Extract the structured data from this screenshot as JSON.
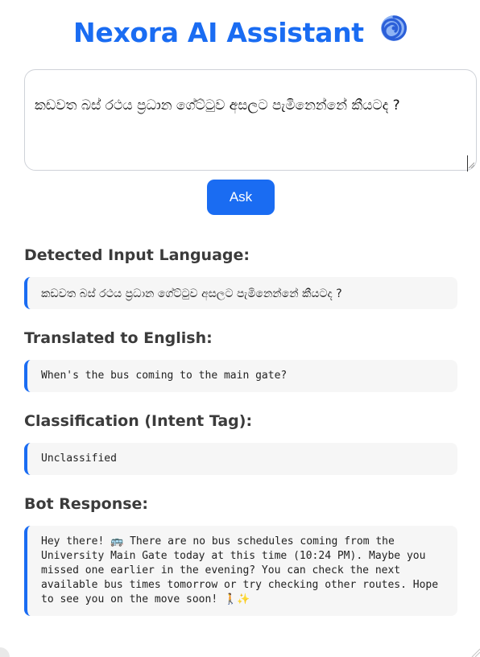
{
  "header": {
    "title": "Nexora AI Assistant",
    "icon": "cyclone-icon",
    "accent_color": "#1a6cf2"
  },
  "input": {
    "value": "කඩවත බස් රථය ප්‍රධාන ගේට්ටුව අසලට පැමිනෙන්නේ කීයටද ?"
  },
  "ask_button": {
    "label": "Ask"
  },
  "sections": {
    "detected": {
      "label": "Detected Input Language:",
      "value": "කඩවත බස් රථය ප්‍රධාන ගේට්ටුව අසලට පැමිනෙන්නේ කීයටද ?"
    },
    "translated": {
      "label": "Translated to English:",
      "value": "When's the bus coming to the main gate?"
    },
    "classification": {
      "label": "Classification (Intent Tag):",
      "value": "Unclassified"
    },
    "response": {
      "label": "Bot Response:",
      "value": "Hey there! 🚌 There are no bus schedules coming from the University Main Gate today at this time (10:24 PM). Maybe you missed one earlier in the evening? You can check the next available bus times tomorrow or try checking other routes. Hope to see you on the move soon! 🚶✨"
    }
  }
}
